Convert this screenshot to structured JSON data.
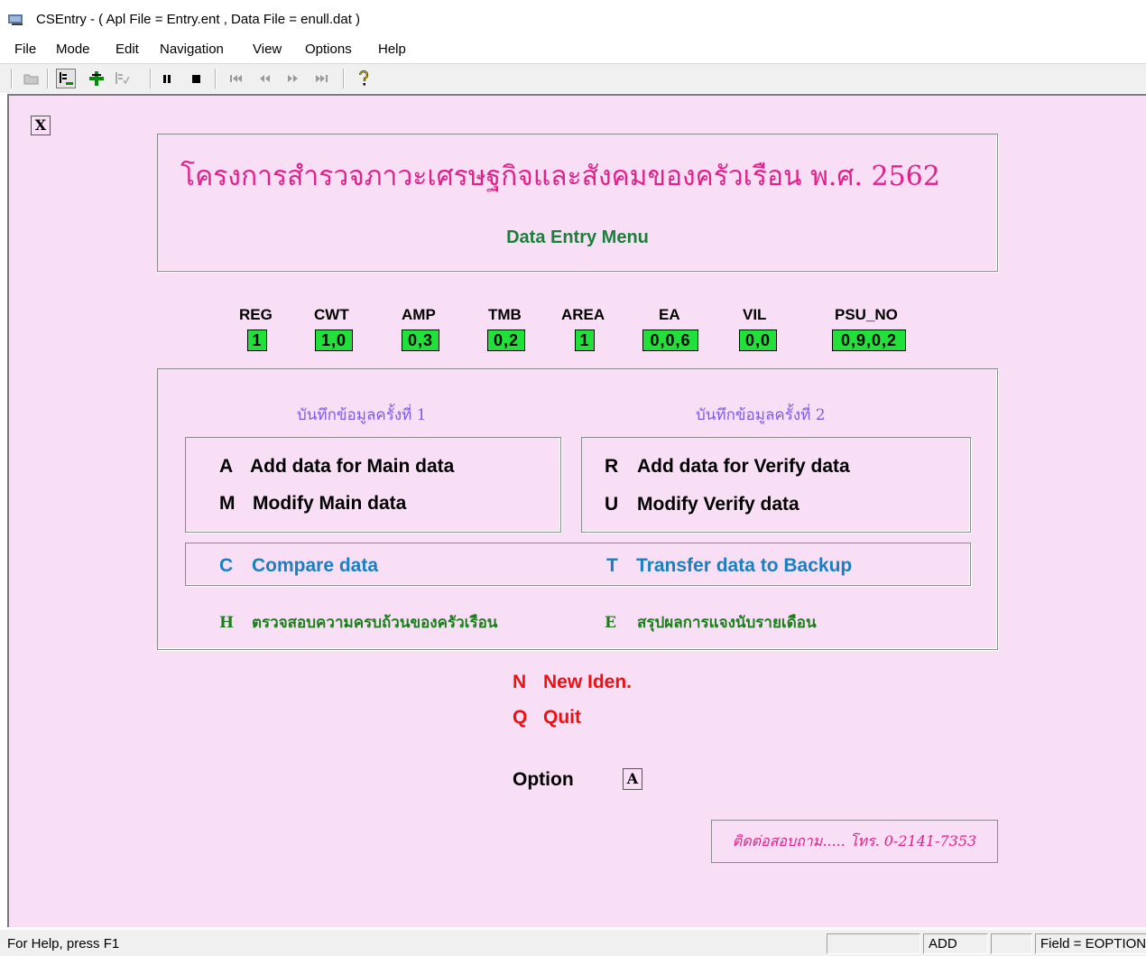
{
  "window": {
    "title": "CSEntry - ( Apl File = Entry.ent , Data File = enull.dat )"
  },
  "menu": [
    "File",
    "Mode",
    "Edit",
    "Navigation",
    "View",
    "Options",
    "Help"
  ],
  "toolbar": {
    "icons": [
      "open-folder-icon",
      "add-mode-icon",
      "modify-mode-icon",
      "verify-mode-icon",
      "pause-icon",
      "stop-icon",
      "first-record-icon",
      "previous-record-icon",
      "next-record-icon",
      "last-record-icon",
      "help-icon"
    ]
  },
  "close_box": "X",
  "header": {
    "title": "โครงการสำรวจภาวะเศรษฐกิจและสังคมของครัวเรือน พ.ศ. 2562",
    "subtitle": "Data Entry Menu"
  },
  "id_fields": [
    {
      "label": "REG",
      "value": "1"
    },
    {
      "label": "CWT",
      "value": "1,0"
    },
    {
      "label": "AMP",
      "value": "0,3"
    },
    {
      "label": "TMB",
      "value": "0,2"
    },
    {
      "label": "AREA",
      "value": "1"
    },
    {
      "label": "EA",
      "value": "0,0,6"
    },
    {
      "label": "VIL",
      "value": "0,0"
    },
    {
      "label": "PSU_NO",
      "value": "0,9,0,2"
    }
  ],
  "section1": {
    "heading": "บันทึกข้อมูลครั้งที่ 1",
    "opt1_key": "A",
    "opt1_label": "Add data for Main data",
    "opt2_key": "M",
    "opt2_label": "Modify Main data"
  },
  "section2": {
    "heading": "บันทึกข้อมูลครั้งที่ 2",
    "opt1_key": "R",
    "opt1_label": "Add data for Verify data",
    "opt2_key": "U",
    "opt2_label": "Modify Verify data"
  },
  "compare": {
    "key": "C",
    "label": "Compare data"
  },
  "transfer": {
    "key": "T",
    "label": "Transfer data to Backup"
  },
  "check": {
    "key": "H",
    "label": "ตรวจสอบความครบถ้วนของครัวเรือน"
  },
  "summary": {
    "key": "E",
    "label": "สรุปผลการแจงนับรายเดือน"
  },
  "new_iden": {
    "key": "N",
    "label": "New Iden."
  },
  "quit": {
    "key": "Q",
    "label": "Quit"
  },
  "option": {
    "label": "Option",
    "value": "A"
  },
  "contact": "ติดต่อสอบถาม..... โทร. 0-2141-7353",
  "status": {
    "help": "For Help, press F1",
    "pane1": "",
    "mode": "ADD",
    "pane3": "",
    "field": "Field = EOPTION"
  },
  "colors": {
    "background": "#f8dff6",
    "title_pink": "#e0218a",
    "subtitle_green": "#1a7f3a",
    "field_green": "#22e03a",
    "heading_purple": "#7b5de0",
    "link_blue": "#1a7fc0",
    "thai_green": "#1a7f1a",
    "red": "#ee1111"
  }
}
